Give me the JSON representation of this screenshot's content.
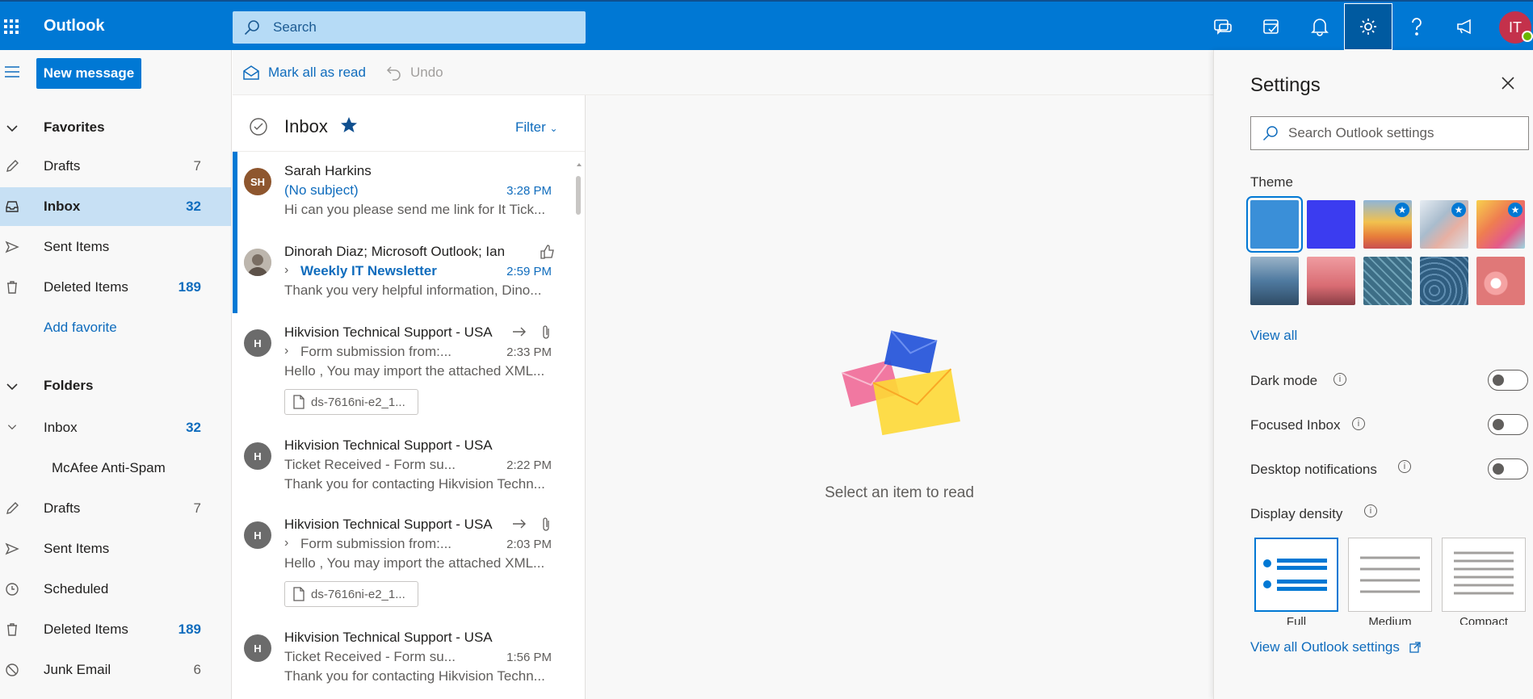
{
  "app": {
    "title": "Outlook"
  },
  "topbar": {
    "search_placeholder": "Search",
    "icons": [
      "skype-chat-icon",
      "my-day-icon",
      "bell-icon",
      "gear-icon",
      "help-icon",
      "feedback-icon"
    ],
    "avatar_initials": "IT"
  },
  "left_nav": {
    "new_message_label": "New message",
    "favorites_label": "Favorites",
    "favorites": [
      {
        "label": "Drafts",
        "count": "7",
        "icon": "pencil-icon"
      },
      {
        "label": "Inbox",
        "count": "32",
        "icon": "inbox-icon",
        "selected": true
      },
      {
        "label": "Sent Items",
        "count": "",
        "icon": "send-icon"
      },
      {
        "label": "Deleted Items",
        "count": "189",
        "icon": "trash-icon"
      }
    ],
    "add_favorite_label": "Add favorite",
    "folders_label": "Folders",
    "folders": [
      {
        "label": "Inbox",
        "count": "32"
      },
      {
        "label": "McAfee Anti-Spam",
        "count": ""
      },
      {
        "label": "Drafts",
        "count": "7",
        "icon": "pencil-icon"
      },
      {
        "label": "Sent Items",
        "count": "",
        "icon": "send-icon"
      },
      {
        "label": "Scheduled",
        "count": "",
        "icon": "clock-icon"
      },
      {
        "label": "Deleted Items",
        "count": "189",
        "icon": "trash-icon"
      },
      {
        "label": "Junk Email",
        "count": "6",
        "icon": "block-icon"
      }
    ]
  },
  "command_bar": {
    "mark_all_read_label": "Mark all as read",
    "undo_label": "Undo"
  },
  "message_list": {
    "title": "Inbox",
    "filter_label": "Filter",
    "messages": [
      {
        "initials": "SH",
        "avatar_color": "#8e562e",
        "sender": "Sarah Harkins",
        "subject": "(No subject)",
        "time": "3:28 PM",
        "preview": "Hi can you please send me link for It Tick...",
        "unread": true
      },
      {
        "initials": "",
        "avatar_color": "#8a8886",
        "sender": "Dinorah Diaz; Microsoft Outlook; Ian",
        "subject": "Weekly IT Newsletter",
        "time": "2:59 PM",
        "preview": "Thank you very helpful information, Dino...",
        "unread": true
      },
      {
        "initials": "H",
        "avatar_color": "#6b6b6b",
        "sender": "Hikvision Technical Support - USA",
        "subject": "Form submission from:...",
        "time": "2:33 PM",
        "preview": "Hello , You may import the attached XML...",
        "attachment": "ds-7616ni-e2_1..."
      },
      {
        "initials": "H",
        "avatar_color": "#6b6b6b",
        "sender": "Hikvision Technical Support - USA",
        "subject": "Ticket Received - Form su...",
        "time": "2:22 PM",
        "preview": "Thank you for contacting Hikvision Techn..."
      },
      {
        "initials": "H",
        "avatar_color": "#6b6b6b",
        "sender": "Hikvision Technical Support - USA",
        "subject": "Form submission from:...",
        "time": "2:03 PM",
        "preview": "Hello , You may import the attached XML...",
        "attachment": "ds-7616ni-e2_1..."
      },
      {
        "initials": "H",
        "avatar_color": "#6b6b6b",
        "sender": "Hikvision Technical Support - USA",
        "subject": "Ticket Received - Form su...",
        "time": "1:56 PM",
        "preview": "Thank you for contacting Hikvision Techn..."
      }
    ]
  },
  "reading_pane": {
    "empty_text": "Select an item to read"
  },
  "settings": {
    "title": "Settings",
    "search_placeholder": "Search Outlook settings",
    "theme_label": "Theme",
    "themes": [
      {
        "color": "#3a8fd8",
        "selected": true
      },
      {
        "color": "#3b3cf0"
      },
      {
        "color": "#e9a04c",
        "premium": true
      },
      {
        "color": "#c9d4de",
        "premium": true
      },
      {
        "color": "#f07c52",
        "premium": true
      },
      {
        "color": "#4d7aa0"
      },
      {
        "color": "#e07b7b"
      },
      {
        "color": "#3d6e86"
      },
      {
        "color": "#2f5d80"
      },
      {
        "color": "#e07878"
      }
    ],
    "view_all_label": "View all",
    "dark_mode_label": "Dark mode",
    "focused_inbox_label": "Focused Inbox",
    "desktop_notifications_label": "Desktop notifications",
    "display_density_label": "Display density",
    "densities": [
      {
        "label": "Full",
        "selected": true
      },
      {
        "label": "Medium"
      },
      {
        "label": "Compact"
      }
    ],
    "view_all_settings_label": "View all Outlook settings"
  }
}
